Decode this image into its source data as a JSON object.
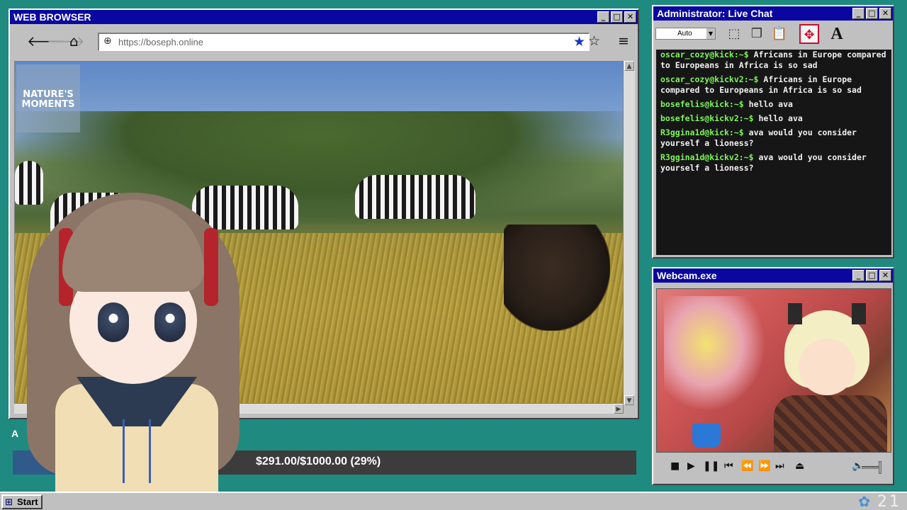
{
  "browser": {
    "title": "WEB BROWSER",
    "url": "https://boseph.online",
    "channel_logo": "NATURE'S MOMENTS"
  },
  "chat": {
    "title": "Administrator: Live Chat",
    "zoom_value": "Auto",
    "messages": [
      {
        "prompt": "oscar_cozy@kick:~$",
        "text": "Africans in Europe compared to Europeans in Africa is so sad"
      },
      {
        "prompt": "oscar_cozy@kickv2:~$",
        "text": "Africans in Europe compared to Europeans in Africa is so sad"
      },
      {
        "prompt": "bosefelis@kick:~$",
        "text": "hello ava"
      },
      {
        "prompt": "bosefelis@kickv2:~$",
        "text": "hello ava"
      },
      {
        "prompt": "R3ggina1d@kick:~$",
        "text": "ava would you consider yourself a lioness?"
      },
      {
        "prompt": "R3ggina1d@kickv2:~$",
        "text": "ava would you consider yourself a lioness?"
      }
    ]
  },
  "webcam": {
    "title": "Webcam.exe"
  },
  "donation": {
    "label": "A",
    "text": "$291.00/$1000.00 (29%)",
    "progress_percent": 29
  },
  "taskbar": {
    "start_label": "Start",
    "clock": "21"
  },
  "colors": {
    "desktop": "#1f8a80",
    "titlebar": "#0a06a0",
    "chat_prompt": "#7cf55a",
    "bookmark_star": "#1b33c9"
  },
  "icons": {
    "back": "arrow-left-icon",
    "forward": "arrow-right-icon",
    "home": "home-icon",
    "globe": "globe-icon",
    "bookmark": "star-filled-icon",
    "favorite": "star-outline-icon",
    "menu": "hamburger-menu-icon"
  }
}
